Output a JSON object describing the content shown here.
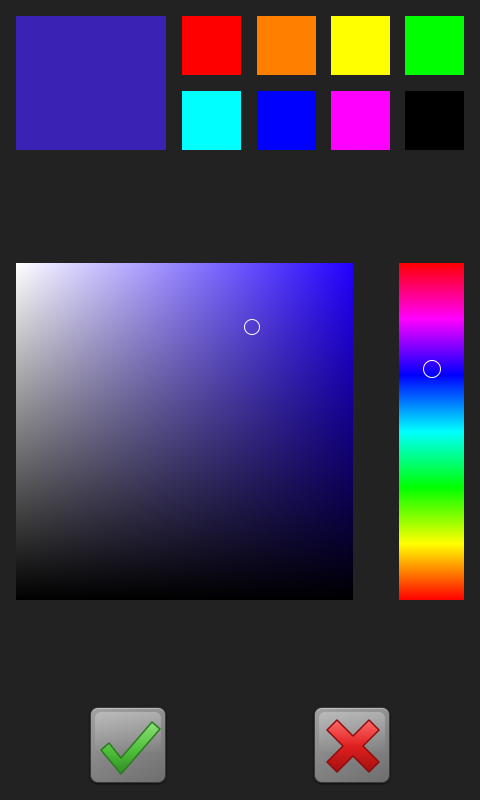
{
  "preview": {
    "color": "#3a22b5"
  },
  "swatches": [
    {
      "name": "red",
      "color": "#ff0000"
    },
    {
      "name": "orange",
      "color": "#ff8000"
    },
    {
      "name": "yellow",
      "color": "#ffff00"
    },
    {
      "name": "green",
      "color": "#00ff00"
    },
    {
      "name": "cyan",
      "color": "#00ffff"
    },
    {
      "name": "blue",
      "color": "#0000ff"
    },
    {
      "name": "magenta",
      "color": "#ff00ff"
    },
    {
      "name": "black",
      "color": "#000000"
    }
  ],
  "picker": {
    "hue_color": "#2200ff",
    "hue_degrees": 247,
    "saturation": 0.7,
    "value": 0.81
  },
  "actions": {
    "ok_icon": "checkmark-icon",
    "cancel_icon": "x-icon"
  }
}
